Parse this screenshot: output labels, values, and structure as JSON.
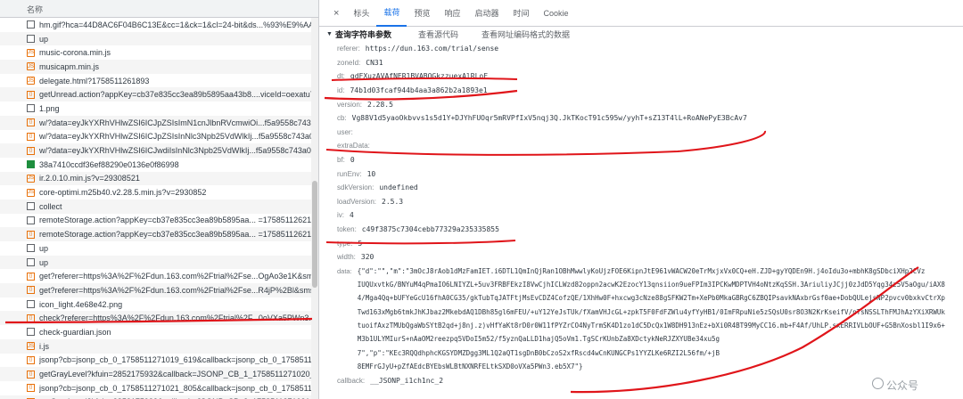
{
  "request_list": {
    "header": "名称",
    "items": [
      {
        "name": "hm.gif?hca=44D8AC6F04B6C13E&cc=1&ck=1&cl=24-bit&ds...%93%E9%AA...",
        "type": "doc"
      },
      {
        "name": "up",
        "type": "doc"
      },
      {
        "name": "music-corona.min.js",
        "type": "script"
      },
      {
        "name": "musicapm.min.js",
        "type": "script"
      },
      {
        "name": "delegate.html?1758511261893",
        "type": "script"
      },
      {
        "name": "getUnread.action?appKey=cb37e835cc3ea89b5895aa43b8....viceId=oexatu7i...",
        "type": "xhr"
      },
      {
        "name": "1.png",
        "type": "doc"
      },
      {
        "name": "w/?data=eyJkYXRhVHlwZSI6ICJpZSIsImN1cnJlbnRVcmwiOi...f5a9558c743a03d...",
        "type": "xhr"
      },
      {
        "name": "w/?data=eyJkYXRhVHlwZSI6ICJpZSIsInNlc3Npb25VdWlkIj...f5a9558c743a03d...",
        "type": "xhr"
      },
      {
        "name": "w/?data=eyJkYXRhVHlwZSI6ICJwdiIsInNlc3Npb25VdWlkIj...f5a9558c743a03d...",
        "type": "xhr"
      },
      {
        "name": "38a7410ccdf36ef88290e0136e0f86998",
        "type": "img"
      },
      {
        "name": "ir.2.0.10.min.js?v=29308521",
        "type": "script"
      },
      {
        "name": "core-optimi.m25b40.v2.28.5.min.js?v=2930852",
        "type": "script"
      },
      {
        "name": "collect",
        "type": "doc"
      },
      {
        "name": "remoteStorage.action?appKey=cb37e835cc3ea89b5895aa... =1758511262128...",
        "type": "doc"
      },
      {
        "name": "remoteStorage.action?appKey=cb37e835cc3ea89b5895aa... =1758511262128...",
        "type": "xhr"
      },
      {
        "name": "up",
        "type": "doc"
      },
      {
        "name": "up",
        "type": "doc"
      },
      {
        "name": "get?referer=https%3A%2F%2Fdun.163.com%2Ftrial%2Fse...OgAo3e1K&sms...",
        "type": "xhr"
      },
      {
        "name": "get?referer=https%3A%2F%2Fdun.163.com%2Ftrial%2Fse...R4jP%2Bl&smsVe...",
        "type": "xhr"
      },
      {
        "name": "icon_light.4e68e42.png",
        "type": "doc"
      },
      {
        "name": "check?referer=https%3A%2F%2Fdun.163.com%2Ftrial%2F...0oVXa5PWn3.eb...",
        "type": "xhr"
      },
      {
        "name": "check-guardian.json",
        "type": "doc"
      },
      {
        "name": "i.js",
        "type": "script"
      },
      {
        "name": "jsonp?cb=jsonp_cb_0_1758511271019_619&callback=jsonp_cb_0_17585112...",
        "type": "xhr"
      },
      {
        "name": "getGrayLevel?kfuin=2852175932&callback=JSONP_CB_1_1758511271020_64...",
        "type": "xhr"
      },
      {
        "name": "jsonp?cb=jsonp_cb_0_1758511271021_805&callback=jsonp_cb_0_17585112...",
        "type": "xhr"
      },
      {
        "name": "getGrayLevel?kfuin=2852175932&callback=JSONP_CB_2_1758511271021_53...",
        "type": "xhr"
      }
    ]
  },
  "tabs": {
    "close": "×",
    "items": [
      "标头",
      "载荷",
      "预览",
      "响应",
      "启动器",
      "时间",
      "Cookie"
    ],
    "active_index": 1
  },
  "payload": {
    "section_title": "查询字符串参数",
    "view_source": "查看源代码",
    "view_decoded": "查看网址编码格式的数据",
    "params": [
      {
        "k": "referer:",
        "v": "https://dun.163.com/trial/sense"
      },
      {
        "k": "zoneId:",
        "v": "CN31"
      },
      {
        "k": "dt:",
        "v": "gdFXuzAVAfNER1BVABQGkzzuexAlRLoF"
      },
      {
        "k": "id:",
        "v": "74b1d03fcaf944b4aa3a862b2a1893e1"
      },
      {
        "k": "version:",
        "v": "2.28.5"
      },
      {
        "k": "cb:",
        "v": "Vg88V1d5yaoOkbvvs1s5d1Y+DJYhFUOqr5mRVPfIxV5nqj3Q.JkTKocT91c595w/yyhT+sZ13T4lL+RoANePyE3BcAv7"
      },
      {
        "k": "user:",
        "v": ""
      },
      {
        "k": "extraData:",
        "v": ""
      },
      {
        "k": "bf:",
        "v": "0"
      },
      {
        "k": "runEnv:",
        "v": "10"
      },
      {
        "k": "sdkVersion:",
        "v": "undefined"
      },
      {
        "k": "loadVersion:",
        "v": "2.5.3"
      },
      {
        "k": "iv:",
        "v": "4"
      },
      {
        "k": "token:",
        "v": "c49f3875c7304cebb77329a235335855"
      },
      {
        "k": "type:",
        "v": "5"
      },
      {
        "k": "width:",
        "v": "320"
      }
    ],
    "data_key": "data:",
    "data_lines": [
      "{\"d\":\"\",\"m\":\"3mOcJ8rAob1dMzFamIET.i6DTL1QmInQjRan1OBhMwwlyKoUjzFOE6KipnJtE961vWACW20eTrMxjxVx0CQ+eH.ZJD+gyYQDEn9H.j4oIdu3o+mbhK8gSDbciXHp2CVz",
      "IUQUxvtkG/BNYuM4qPmaIO6LNIYZL+5uv3FRBFEkzI8VwCjhICLWzd82oppn2acwK2EzocY13qnsiion9ueFPIm3IPCKwMDPTVH4oNtzKqSSH.3AriuliyJCjj0zJdD5Yqg34z5V5aOgu/iAX8",
      "4/Mga4Qq+bUFYeGcU16fhA0CG35/gkTubTqJATFtjMsEvCDZ4CofzQE/1XhHw0F+hxcwg3cNze88gSFKW2Tm+XePb0MkaGBRgC6ZBQIPsavkNAxbrGsf0ae+DobQULejsNP2pvcv0bxkvCtrXp",
      "Twd163xMgb6tmkJhKJbaz2MkebdAQ1DBh85gl6mFEU/+uY12YeJsTUk/fXamVHJcGL+zpkT5F0FdFZWlu4yfYyHB1/0ImFRpuNie5zSQsU0sr8O3N2KrKseifV/nTsNSSLThFMJhAzYXiXRWUk",
      "tuoifAxzTMUbQgaWbSYtB2qd+j8nj.z)vHfYaKt8rD0r0W11fPYZrCO4NyTrmSK4D1zo1dC5DcQx1W8DH913nEz+bXi0R4BT99MyCC16.mb+F4Af/UhLP.sxERRIVLbOUF+G5BnXosbl1I9x6+",
      "M3b1ULYMIurS+nAaOM2reezpq5VDoI5m52/f5yznQaLLD1hajQ5oVm1.TgSCrKUnbZa8XDctykNeRJZXYUBe34xu5g",
      "7\",\"p\":\"KEc3RQQdhphcKGSYDMZDgg3ML1Q2aQT1sgDnB0bCzoS2xfRscd4wCnKUNGCPs1YYZLKe6RZI2L56fm/+jB",
      "8EMFrGJyU+pZfAEdcBYEbsWLBtNXNRFELtkSXD0oVXa5PWn3.eb5X7\"}"
    ],
    "callback_key": "callback:",
    "callback_value": "__JSONP_i1ch1nc_2"
  },
  "watermark": "公众号"
}
